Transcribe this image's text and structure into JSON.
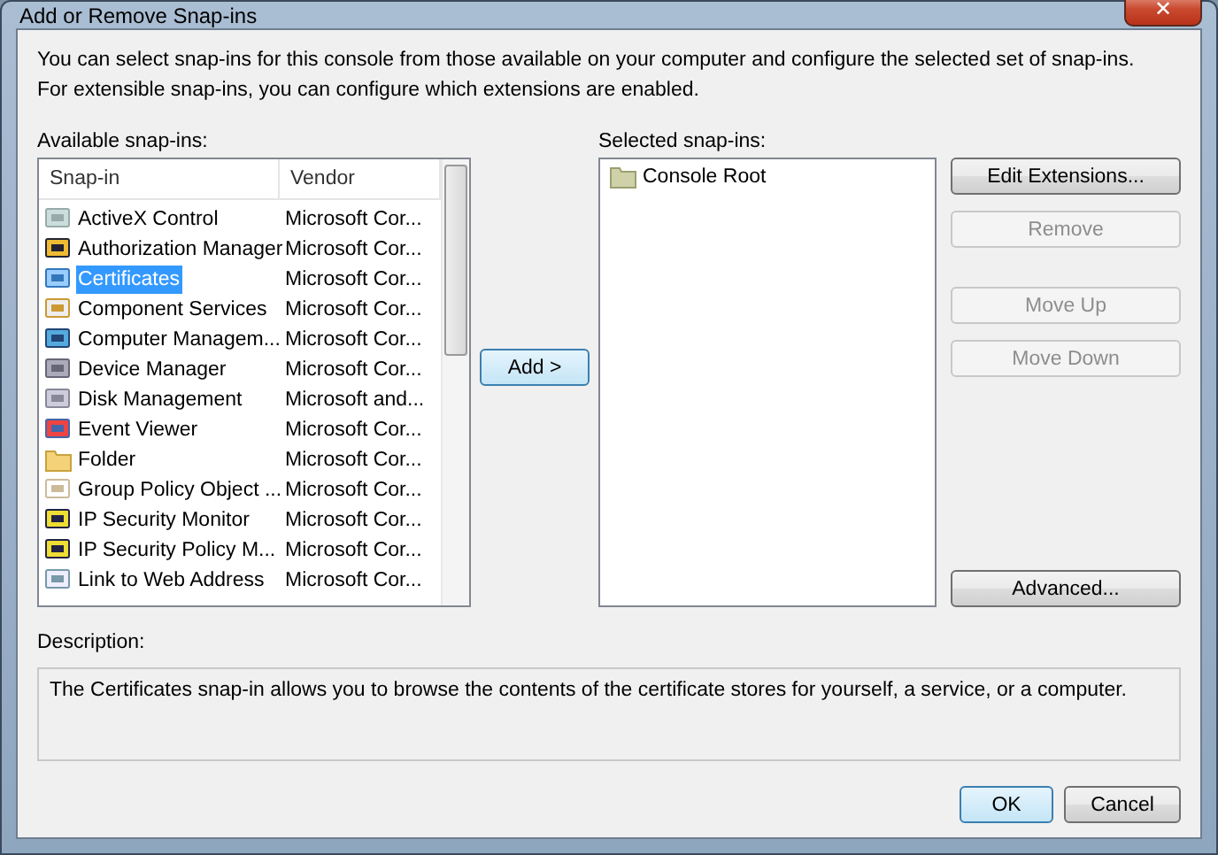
{
  "window": {
    "title": "Add or Remove Snap-ins",
    "close": "✕"
  },
  "intro": "You can select snap-ins for this console from those available on your computer and configure the selected set of snap-ins. For extensible snap-ins, you can configure which extensions are enabled.",
  "available": {
    "label": "Available snap-ins:",
    "columns": [
      "Snap-in",
      "Vendor"
    ],
    "rows": [
      {
        "name": "ActiveX Control",
        "vendor": "Microsoft Cor...",
        "selected": false
      },
      {
        "name": "Authorization Manager",
        "vendor": "Microsoft Cor...",
        "selected": false
      },
      {
        "name": "Certificates",
        "vendor": "Microsoft Cor...",
        "selected": true
      },
      {
        "name": "Component Services",
        "vendor": "Microsoft Cor...",
        "selected": false
      },
      {
        "name": "Computer Managem...",
        "vendor": "Microsoft Cor...",
        "selected": false
      },
      {
        "name": "Device Manager",
        "vendor": "Microsoft Cor...",
        "selected": false
      },
      {
        "name": "Disk Management",
        "vendor": "Microsoft and...",
        "selected": false
      },
      {
        "name": "Event Viewer",
        "vendor": "Microsoft Cor...",
        "selected": false
      },
      {
        "name": "Folder",
        "vendor": "Microsoft Cor...",
        "selected": false
      },
      {
        "name": "Group Policy Object ...",
        "vendor": "Microsoft Cor...",
        "selected": false
      },
      {
        "name": "IP Security Monitor",
        "vendor": "Microsoft Cor...",
        "selected": false
      },
      {
        "name": "IP Security Policy M...",
        "vendor": "Microsoft Cor...",
        "selected": false
      },
      {
        "name": "Link to Web Address",
        "vendor": "Microsoft Cor...",
        "selected": false
      }
    ]
  },
  "add_button": {
    "label": "Add >",
    "disabled": false
  },
  "selected_snapins": {
    "label": "Selected snap-ins:",
    "items": [
      {
        "name": "Console Root"
      }
    ]
  },
  "side_buttons": [
    {
      "label": "Edit Extensions...",
      "disabled": false
    },
    {
      "label": "Remove",
      "disabled": true
    },
    {
      "label": "Move Up",
      "disabled": true
    },
    {
      "label": "Move Down",
      "disabled": true
    },
    {
      "label": "Advanced...",
      "disabled": false
    }
  ],
  "description": {
    "label": "Description:",
    "text": "The Certificates snap-in allows you to browse the contents of the certificate stores for yourself, a service, or a computer."
  },
  "footer_buttons": [
    {
      "label": "OK",
      "default": true
    },
    {
      "label": "Cancel",
      "default": false
    }
  ]
}
